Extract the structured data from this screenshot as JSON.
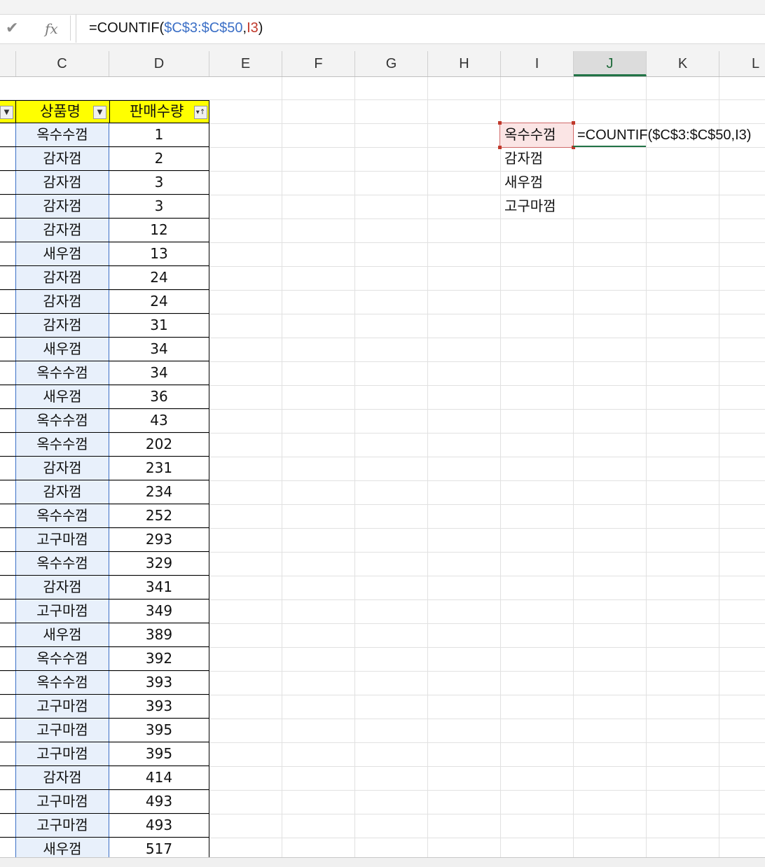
{
  "formula_bar": {
    "cancel_icon": "check-icon",
    "fx_label": "fx",
    "formula_prefix": "=COUNTIF(",
    "formula_range": "$C$3:$C$50",
    "formula_comma": ",",
    "formula_ref": "I3",
    "formula_suffix": ")"
  },
  "columns": [
    "C",
    "D",
    "E",
    "F",
    "G",
    "H",
    "I",
    "J",
    "K",
    "L"
  ],
  "active_column": "J",
  "table": {
    "header_c": "상품명",
    "header_d": "판매수량",
    "rows": [
      {
        "name": "옥수수껌",
        "qty": "1"
      },
      {
        "name": "감자껌",
        "qty": "2"
      },
      {
        "name": "감자껌",
        "qty": "3"
      },
      {
        "name": "감자껌",
        "qty": "3"
      },
      {
        "name": "감자껌",
        "qty": "12"
      },
      {
        "name": "새우껌",
        "qty": "13"
      },
      {
        "name": "감자껌",
        "qty": "24"
      },
      {
        "name": "감자껌",
        "qty": "24"
      },
      {
        "name": "감자껌",
        "qty": "31"
      },
      {
        "name": "새우껌",
        "qty": "34"
      },
      {
        "name": "옥수수껌",
        "qty": "34"
      },
      {
        "name": "새우껌",
        "qty": "36"
      },
      {
        "name": "옥수수껌",
        "qty": "43"
      },
      {
        "name": "옥수수껌",
        "qty": "202"
      },
      {
        "name": "감자껌",
        "qty": "231"
      },
      {
        "name": "감자껌",
        "qty": "234"
      },
      {
        "name": "옥수수껌",
        "qty": "252"
      },
      {
        "name": "고구마껌",
        "qty": "293"
      },
      {
        "name": "옥수수껌",
        "qty": "329"
      },
      {
        "name": "감자껌",
        "qty": "341"
      },
      {
        "name": "고구마껌",
        "qty": "349"
      },
      {
        "name": "새우껌",
        "qty": "389"
      },
      {
        "name": "옥수수껌",
        "qty": "392"
      },
      {
        "name": "옥수수껌",
        "qty": "393"
      },
      {
        "name": "고구마껌",
        "qty": "393"
      },
      {
        "name": "고구마껌",
        "qty": "395"
      },
      {
        "name": "고구마껌",
        "qty": "395"
      },
      {
        "name": "감자껌",
        "qty": "414"
      },
      {
        "name": "고구마껌",
        "qty": "493"
      },
      {
        "name": "고구마껌",
        "qty": "493"
      },
      {
        "name": "새우껌",
        "qty": "517"
      }
    ]
  },
  "criteria_list": [
    "옥수수껌",
    "감자껌",
    "새우껌",
    "고구마껌"
  ],
  "editing_cell_text": "=COUNTIF($C$3:$C$50,I3)"
}
